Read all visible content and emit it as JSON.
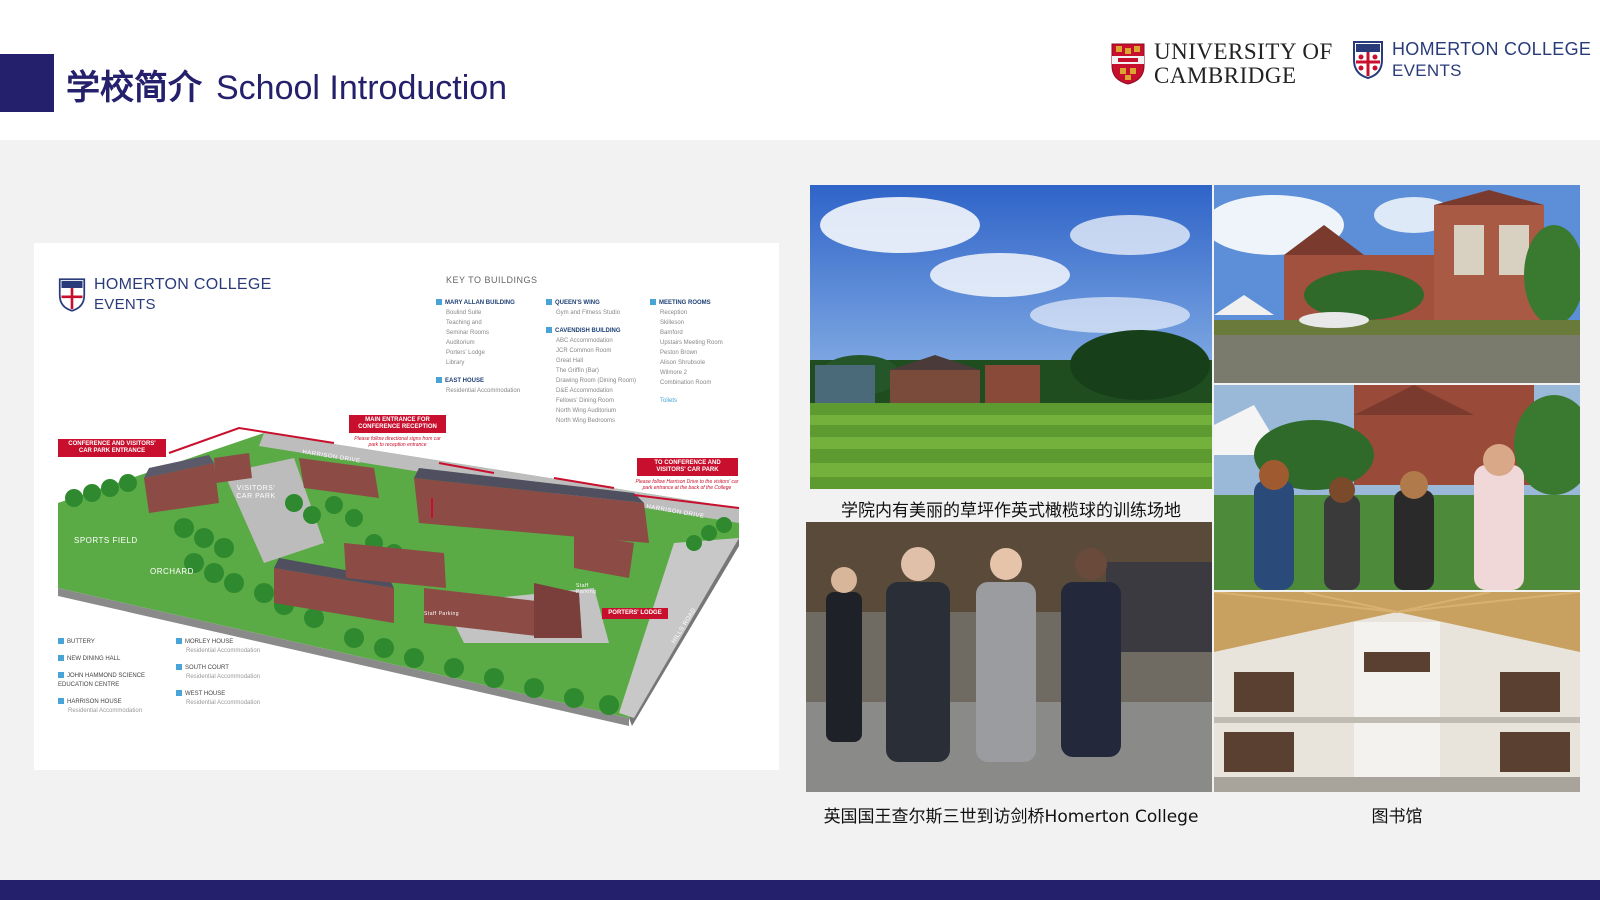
{
  "header": {
    "title_cn": "学校简介",
    "title_en": "School Introduction",
    "cambridge_line1": "UNIVERSITY OF",
    "cambridge_line2": "CAMBRIDGE",
    "homerton_line1": "HOMERTON COLLEGE",
    "homerton_line2": "EVENTS"
  },
  "map": {
    "logo_line1": "HOMERTON COLLEGE",
    "logo_line2": "EVENTS",
    "key_title": "KEY TO BUILDINGS",
    "key_col1": {
      "head1": "MARY ALLAN BUILDING",
      "items1": [
        "Boulind Suite",
        "Teaching and",
        "Seminar Rooms",
        "Auditorium",
        "Porters' Lodge",
        "Library"
      ],
      "head2": "EAST HOUSE",
      "items2": [
        "Residential Accommodation"
      ]
    },
    "key_col2": {
      "head1": "QUEEN'S WING",
      "items1": [
        "Gym and Fitness Studio"
      ],
      "head2": "CAVENDISH BUILDING",
      "items2": [
        "ABC Accommodation",
        "JCR Common Room",
        "Great Hall",
        "The Griffin (Bar)",
        "Drawing Room (Dining Room)",
        "D&E Accommodation",
        "Fellows' Dining Room",
        "North Wing Auditorium",
        "North Wing Bedrooms"
      ]
    },
    "key_col3": {
      "head1": "MEETING ROOMS",
      "items1": [
        "Reception",
        "Skilleson",
        "Bamford",
        "Upstairs Meeting Room",
        "Peston Brown",
        "Alison Shrubsole",
        "Wilmore 2",
        "Combination Room"
      ],
      "toilets": "Toilets"
    },
    "bottom_col1": [
      {
        "name": "BUTTERY",
        "sub": ""
      },
      {
        "name": "NEW DINING HALL",
        "sub": ""
      },
      {
        "name": "JOHN HAMMOND SCIENCE EDUCATION CENTRE",
        "sub": ""
      },
      {
        "name": "HARRISON HOUSE",
        "sub": "Residential Accommodation"
      }
    ],
    "bottom_col2": [
      {
        "name": "MORLEY HOUSE",
        "sub": "Residential Accommodation"
      },
      {
        "name": "SOUTH COURT",
        "sub": "Residential Accommodation"
      },
      {
        "name": "WEST HOUSE",
        "sub": "Residential Accommodation"
      }
    ],
    "label_conf_entrance": "CONFERENCE AND VISITORS' CAR PARK ENTRANCE",
    "label_main_entrance": "MAIN ENTRANCE FOR CONFERENCE RECEPTION",
    "note_main_entrance": "Please follow directional signs from car park to reception entrance",
    "label_to_carpark": "TO CONFERENCE AND VISITORS' CAR PARK",
    "note_to_carpark": "Please follow Harrison Drive to the visitors' car park entrance at the back of the College",
    "label_porters": "PORTERS' LODGE",
    "text_sports_field": "SPORTS FIELD",
    "text_orchard": "ORCHARD",
    "text_visitors_carpark": "VISITORS' CAR PARK",
    "text_harrison_drive": "HARRISON DRIVE",
    "text_harrison_drive2": "HARRISON DRIVE",
    "text_hills_road": "HILLS ROAD",
    "text_staff_parking": "Staff Parking",
    "text_staff_parking2": "Staff Parking"
  },
  "captions": {
    "lawn": "学院内有美丽的草坪作英式橄榄球的训练场地",
    "king": "英国国王查尔斯三世到访剑桥Homerton College",
    "library": "图书馆"
  },
  "colors": {
    "navy": "#25206b",
    "red": "#c8102e",
    "grass": "#5aab45"
  }
}
